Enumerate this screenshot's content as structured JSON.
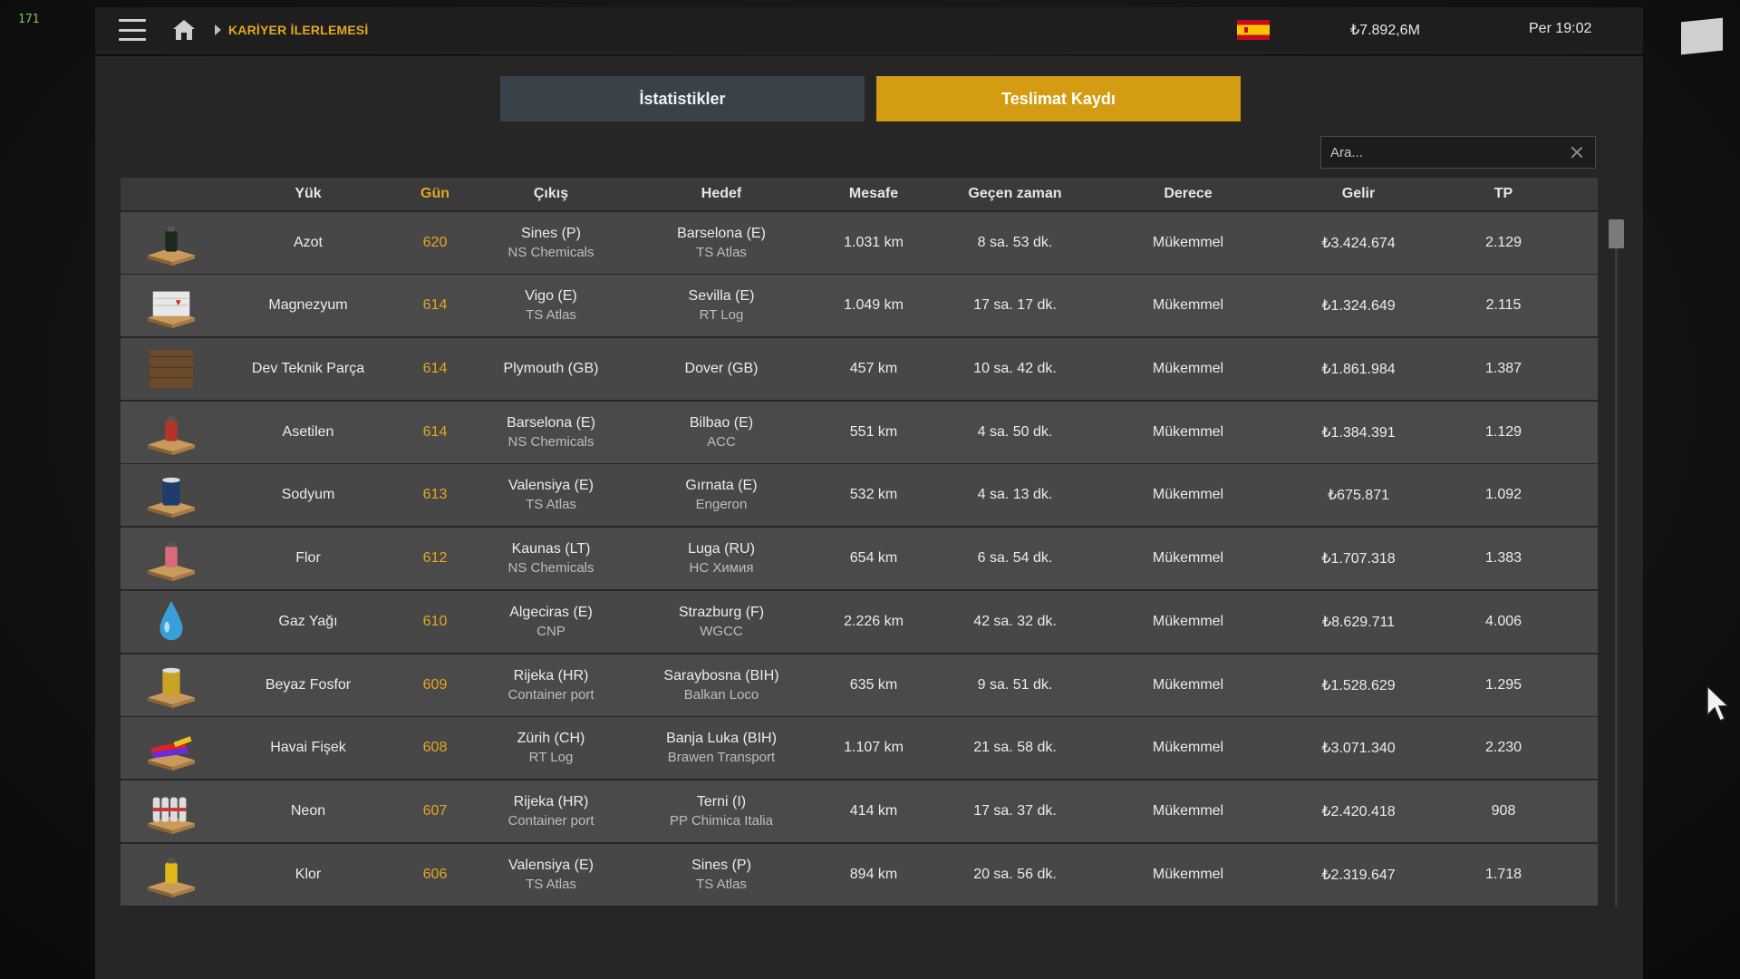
{
  "fps": "171",
  "topbar": {
    "breadcrumb": "KARİYER İLERLEMESİ",
    "money": "₺7.892,6M",
    "clock": "Per 19:02",
    "icons": [
      "menu-icon",
      "home-icon",
      "spain-flag-icon"
    ]
  },
  "tabs": {
    "stats": "İstatistikler",
    "log": "Teslimat Kaydı",
    "active": "log",
    "active_color": "#d39c12",
    "inactive_color": "#3a4249"
  },
  "search": {
    "placeholder": "Ara..."
  },
  "table": {
    "headers": {
      "cargo": "Yük",
      "day": "Gün",
      "from": "Çıkış",
      "to": "Hedef",
      "distance": "Mesafe",
      "time": "Geçen zaman",
      "grade": "Derece",
      "income": "Gelir",
      "tp": "TP"
    },
    "rows": [
      {
        "icon": "black-canister-pallet-icon",
        "cargo": "Azot",
        "day": "620",
        "from_city": "Sines (P)",
        "from_company": "NS Chemicals",
        "to_city": "Barselona (E)",
        "to_company": "TS Atlas",
        "distance": "1.031 km",
        "time": "8 sa. 53 dk.",
        "grade": "Mükemmel",
        "income": "₺3.424.674",
        "tp": "2.129"
      },
      {
        "icon": "sacks-pallet-icon",
        "cargo": "Magnezyum",
        "day": "614",
        "from_city": "Vigo (E)",
        "from_company": "TS Atlas",
        "to_city": "Sevilla (E)",
        "to_company": "RT Log",
        "distance": "1.049 km",
        "time": "17 sa. 17 dk.",
        "grade": "Mükemmel",
        "income": "₺1.324.649",
        "tp": "2.115"
      },
      {
        "icon": "wooden-crate-icon",
        "cargo": "Dev Teknik Parça",
        "day": "614",
        "from_city": "Plymouth (GB)",
        "from_company": "",
        "to_city": "Dover (GB)",
        "to_company": "",
        "distance": "457 km",
        "time": "10 sa. 42 dk.",
        "grade": "Mükemmel",
        "income": "₺1.861.984",
        "tp": "1.387"
      },
      {
        "icon": "red-canister-pallet-icon",
        "cargo": "Asetilen",
        "day": "614",
        "from_city": "Barselona (E)",
        "from_company": "NS Chemicals",
        "to_city": "Bilbao (E)",
        "to_company": "ACC",
        "distance": "551 km",
        "time": "4 sa. 50 dk.",
        "grade": "Mükemmel",
        "income": "₺1.384.391",
        "tp": "1.129"
      },
      {
        "icon": "blue-barrel-pallet-icon",
        "cargo": "Sodyum",
        "day": "613",
        "from_city": "Valensiya (E)",
        "from_company": "TS Atlas",
        "to_city": "Gırnata (E)",
        "to_company": "Engeron",
        "distance": "532 km",
        "time": "4 sa. 13 dk.",
        "grade": "Mükemmel",
        "income": "₺675.871",
        "tp": "1.092"
      },
      {
        "icon": "pink-canister-pallet-icon",
        "cargo": "Flor",
        "day": "612",
        "from_city": "Kaunas (LT)",
        "from_company": "NS Chemicals",
        "to_city": "Luga (RU)",
        "to_company": "НС Химия",
        "distance": "654 km",
        "time": "6 sa. 54 dk.",
        "grade": "Mükemmel",
        "income": "₺1.707.318",
        "tp": "1.383"
      },
      {
        "icon": "oil-drop-icon",
        "cargo": "Gaz Yağı",
        "day": "610",
        "from_city": "Algeciras (E)",
        "from_company": "CNP",
        "to_city": "Strazburg (F)",
        "to_company": "WGCC",
        "distance": "2.226 km",
        "time": "42 sa. 32 dk.",
        "grade": "Mükemmel",
        "income": "₺8.629.711",
        "tp": "4.006"
      },
      {
        "icon": "yellow-barrel-pallet-icon",
        "cargo": "Beyaz Fosfor",
        "day": "609",
        "from_city": "Rijeka (HR)",
        "from_company": "Container port",
        "to_city": "Saraybosna (BIH)",
        "to_company": "Balkan Loco",
        "distance": "635 km",
        "time": "9 sa. 51 dk.",
        "grade": "Mükemmel",
        "income": "₺1.528.629",
        "tp": "1.295"
      },
      {
        "icon": "fireworks-pallet-icon",
        "cargo": "Havai Fişek",
        "day": "608",
        "from_city": "Zürih (CH)",
        "from_company": "RT Log",
        "to_city": "Banja Luka (BIH)",
        "to_company": "Brawen Transport",
        "distance": "1.107 km",
        "time": "21 sa. 58 dk.",
        "grade": "Mükemmel",
        "income": "₺3.071.340",
        "tp": "2.230"
      },
      {
        "icon": "gas-bottles-pallet-icon",
        "cargo": "Neon",
        "day": "607",
        "from_city": "Rijeka (HR)",
        "from_company": "Container port",
        "to_city": "Terni (I)",
        "to_company": "PP Chimica Italia",
        "distance": "414 km",
        "time": "17 sa. 37 dk.",
        "grade": "Mükemmel",
        "income": "₺2.420.418",
        "tp": "908"
      },
      {
        "icon": "yellow-canister-pallet-icon",
        "cargo": "Klor",
        "day": "606",
        "from_city": "Valensiya (E)",
        "from_company": "TS Atlas",
        "to_city": "Sines (P)",
        "to_company": "TS Atlas",
        "distance": "894 km",
        "time": "20 sa. 56 dk.",
        "grade": "Mükemmel",
        "income": "₺2.319.647",
        "tp": "1.718"
      }
    ]
  },
  "colors": {
    "accent": "#e5a722",
    "row": "#4a4a4a",
    "header": "#3a3a3a"
  }
}
